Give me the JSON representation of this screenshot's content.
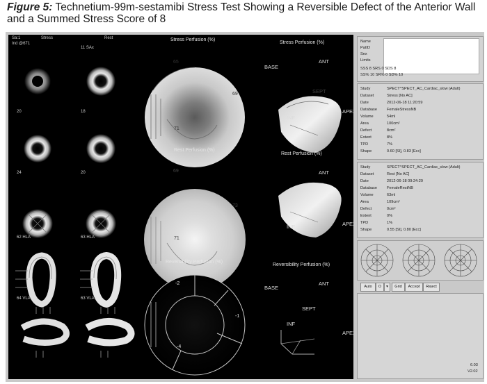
{
  "caption": {
    "figure_label": "Figure 5:",
    "text": "Technetium-99m-sestamibi Stress Test Showing a Reversible Defect of the Anterior Wall and a Summed Stress Score of 8"
  },
  "slices": {
    "col_stress": "Stress",
    "col_rest": "Rest",
    "ax_label": "Sa:1",
    "ind_label": "Ind @671",
    "stress_labels": [
      "",
      "20",
      "24",
      "62 HLA",
      "64 VLA"
    ],
    "rest_labels": [
      "11 SAx",
      "18",
      "20",
      "63 HLA",
      "63 VLA"
    ]
  },
  "polar_maps": {
    "stress_title": "Stress Perfusion (%)",
    "stress_values": [
      "65",
      "69",
      "71"
    ],
    "rest_title": "Rest Perfusion (%)",
    "rest_values": [
      "69",
      "73",
      "71"
    ],
    "rev_title": "Reversibility Perfusion (%)",
    "rev_values": [
      "-2",
      "-1",
      "-4"
    ]
  },
  "views_3d": {
    "stress_title": "Stress Perfusion (%)",
    "rest_title": "Rest Perfusion (%)",
    "rev_title": "Reversibility Perfusion (%)",
    "base": "BASE",
    "ant": "ANT",
    "inf": "INF",
    "apex": "APEX",
    "sept": "SEPT"
  },
  "info_top": {
    "rows": [
      "Name",
      "PatID",
      "Sex",
      "Limits"
    ],
    "scores_1": "SSS 8     SRS 0     SDS 8",
    "scores_2": "SS% 10    SR% 0     SD% 10"
  },
  "stress_info": {
    "keys": [
      "Study",
      "Dataset",
      "Date",
      "Database",
      "Volume",
      "Area",
      "Defect",
      "Extent",
      "TPD",
      "Shape"
    ],
    "vals": [
      "SPECT^SPECT_AC_Cardiac_slow (Adult)",
      "Stress [No AC]",
      "2012-06-18 11:20:59",
      "FemaleStressNB",
      "54ml",
      "100cm²",
      "8cm²",
      "8%",
      "7%",
      "0.60 [SI], 0.83 [Ecc]"
    ]
  },
  "rest_info": {
    "keys": [
      "Study",
      "Dataset",
      "Date",
      "Database",
      "Volume",
      "Area",
      "Defect",
      "Extent",
      "TPD",
      "Shape"
    ],
    "vals": [
      "SPECT^SPECT_AC_Cardiac_slow (Adult)",
      "Rest [No AC]",
      "2012-06-18 09:24:29",
      "FemaleRestNB",
      "63ml",
      "109cm²",
      "0cm²",
      "0%",
      "1%",
      "0.55 [SI], 0.80 [Ecc]"
    ]
  },
  "controls": {
    "auto": "Auto",
    "o": "O",
    "grid": "Grid",
    "accept": "Accept",
    "reject": "Reject"
  },
  "footer": {
    "code1": "6.03",
    "code2": "V2.02"
  }
}
